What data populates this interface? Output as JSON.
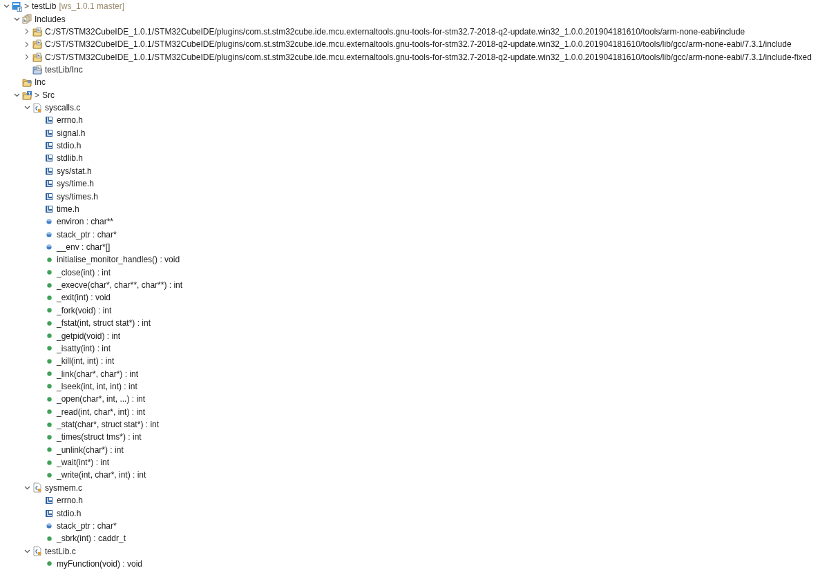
{
  "tree": [
    {
      "kind": "project",
      "decoration": ">",
      "label": "testLib",
      "suffix": "[ws_1.0.1 master]",
      "expanded": true,
      "children": [
        {
          "kind": "includes",
          "label": "Includes",
          "expanded": true,
          "children": [
            {
              "kind": "include-folder",
              "label": "C:/ST/STM32CubeIDE_1.0.1/STM32CubeIDE/plugins/com.st.stm32cube.ide.mcu.externaltools.gnu-tools-for-stm32.7-2018-q2-update.win32_1.0.0.201904181610/tools/arm-none-eabi/include",
              "expanded": false
            },
            {
              "kind": "include-folder",
              "label": "C:/ST/STM32CubeIDE_1.0.1/STM32CubeIDE/plugins/com.st.stm32cube.ide.mcu.externaltools.gnu-tools-for-stm32.7-2018-q2-update.win32_1.0.0.201904181610/tools/lib/gcc/arm-none-eabi/7.3.1/include",
              "expanded": false
            },
            {
              "kind": "include-folder",
              "label": "C:/ST/STM32CubeIDE_1.0.1/STM32CubeIDE/plugins/com.st.stm32cube.ide.mcu.externaltools.gnu-tools-for-stm32.7-2018-q2-update.win32_1.0.0.201904181610/tools/lib/gcc/arm-none-eabi/7.3.1/include-fixed",
              "expanded": false
            },
            {
              "kind": "project-include",
              "label": "testLib/Inc"
            }
          ]
        },
        {
          "kind": "folder",
          "label": "Inc"
        },
        {
          "kind": "source-folder",
          "decoration": ">",
          "label": "Src",
          "expanded": true,
          "children": [
            {
              "kind": "c-file",
              "label": "syscalls.c",
              "expanded": true,
              "children": [
                {
                  "kind": "header",
                  "label": "errno.h"
                },
                {
                  "kind": "header",
                  "label": "signal.h"
                },
                {
                  "kind": "header",
                  "label": "stdio.h"
                },
                {
                  "kind": "header",
                  "label": "stdlib.h"
                },
                {
                  "kind": "header",
                  "label": "sys/stat.h"
                },
                {
                  "kind": "header",
                  "label": "sys/time.h"
                },
                {
                  "kind": "header",
                  "label": "sys/times.h"
                },
                {
                  "kind": "header",
                  "label": "time.h"
                },
                {
                  "kind": "variable",
                  "label": "environ : char**"
                },
                {
                  "kind": "variable",
                  "label": "stack_ptr : char*"
                },
                {
                  "kind": "variable",
                  "label": "__env : char*[]"
                },
                {
                  "kind": "function",
                  "label": "initialise_monitor_handles() : void"
                },
                {
                  "kind": "function",
                  "label": "_close(int) : int"
                },
                {
                  "kind": "function",
                  "label": "_execve(char*, char**, char**) : int"
                },
                {
                  "kind": "function",
                  "label": "_exit(int) : void"
                },
                {
                  "kind": "function",
                  "label": "_fork(void) : int"
                },
                {
                  "kind": "function",
                  "label": "_fstat(int, struct stat*) : int"
                },
                {
                  "kind": "function",
                  "label": "_getpid(void) : int"
                },
                {
                  "kind": "function",
                  "label": "_isatty(int) : int"
                },
                {
                  "kind": "function",
                  "label": "_kill(int, int) : int"
                },
                {
                  "kind": "function",
                  "label": "_link(char*, char*) : int"
                },
                {
                  "kind": "function",
                  "label": "_lseek(int, int, int) : int"
                },
                {
                  "kind": "function",
                  "label": "_open(char*, int, ...) : int"
                },
                {
                  "kind": "function",
                  "label": "_read(int, char*, int) : int"
                },
                {
                  "kind": "function",
                  "label": "_stat(char*, struct stat*) : int"
                },
                {
                  "kind": "function",
                  "label": "_times(struct tms*) : int"
                },
                {
                  "kind": "function",
                  "label": "_unlink(char*) : int"
                },
                {
                  "kind": "function",
                  "label": "_wait(int*) : int"
                },
                {
                  "kind": "function",
                  "label": "_write(int, char*, int) : int"
                }
              ]
            },
            {
              "kind": "c-file",
              "label": "sysmem.c",
              "expanded": true,
              "children": [
                {
                  "kind": "header",
                  "label": "errno.h"
                },
                {
                  "kind": "header",
                  "label": "stdio.h"
                },
                {
                  "kind": "variable",
                  "label": "stack_ptr : char*"
                },
                {
                  "kind": "function",
                  "label": "_sbrk(int) : caddr_t"
                }
              ]
            },
            {
              "kind": "c-file",
              "label": "testLib.c",
              "expanded": true,
              "children": [
                {
                  "kind": "function",
                  "label": "myFunction(void) : void"
                }
              ]
            }
          ]
        }
      ]
    }
  ]
}
